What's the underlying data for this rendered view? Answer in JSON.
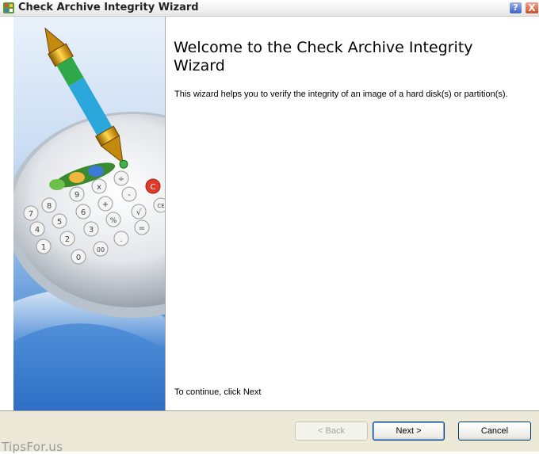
{
  "window": {
    "title": "Check Archive Integrity Wizard",
    "help_label": "?",
    "close_label": "X"
  },
  "art": {
    "keys": [
      "7",
      "8",
      "9",
      "x",
      "÷",
      "4",
      "5",
      "6",
      "+",
      "-",
      "1",
      "2",
      "3",
      "%",
      "0",
      "00",
      ".",
      "=",
      "C",
      "CE",
      "√"
    ]
  },
  "main": {
    "heading": "Welcome to the Check Archive Integrity Wizard",
    "description": "This wizard helps you to verify the integrity of an image of a hard disk(s) or partition(s).",
    "continue_text": "To continue, click Next"
  },
  "buttons": {
    "back": "< Back",
    "next": "Next >",
    "cancel": "Cancel"
  },
  "watermark": "TipsFor.us",
  "colors": {
    "accent_blue": "#3e63cb",
    "close_red": "#d24b27",
    "panel_bg": "#ece9d8"
  }
}
